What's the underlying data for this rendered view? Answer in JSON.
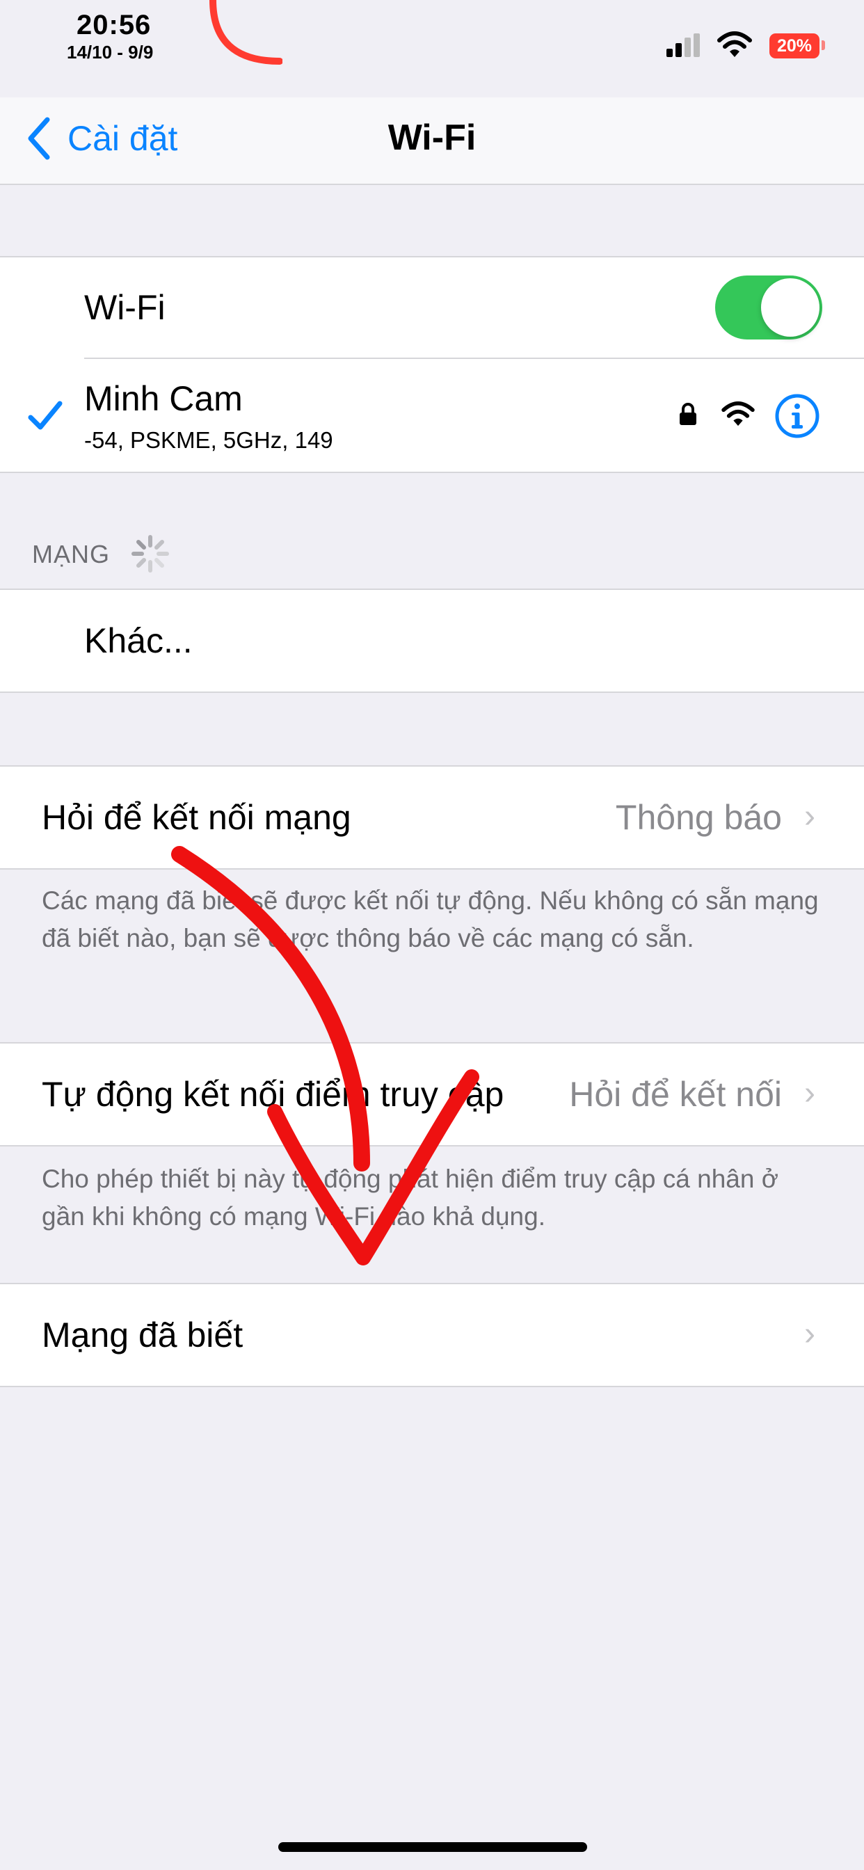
{
  "status_bar": {
    "time": "20:56",
    "date": "14/10 - 9/9",
    "battery": "20%",
    "icons": [
      "signal-icon",
      "wifi-icon",
      "battery-icon"
    ]
  },
  "nav": {
    "back_label": "Cài đặt",
    "title": "Wi-Fi"
  },
  "wifi": {
    "label": "Wi-Fi",
    "enabled": true,
    "current_network": {
      "name": "Minh Cam",
      "details": "-54, PSKME, 5GHz, 149"
    }
  },
  "networks": {
    "header": "MẠNG",
    "other": "Khác..."
  },
  "ask_to_join": {
    "label": "Hỏi để kết nối mạng",
    "value": "Thông báo",
    "footer": "Các mạng đã biết sẽ được kết nối tự động. Nếu không có sẵn mạng đã biết nào, bạn sẽ được thông báo về các mạng có sẵn."
  },
  "auto_join_hotspot": {
    "label": "Tự động kết nối điểm truy cập",
    "value": "Hỏi để kết nối",
    "footer": "Cho phép thiết bị này tự động phát hiện điểm truy cập cá nhân ở gần khi không có mạng Wi-Fi nào khả dụng."
  },
  "known_networks": {
    "label": "Mạng đã biết"
  },
  "colors": {
    "accent": "#0a84ff",
    "toggle_on": "#34c759",
    "battery_low": "#ff3b30",
    "annotation": "#ee1111"
  }
}
